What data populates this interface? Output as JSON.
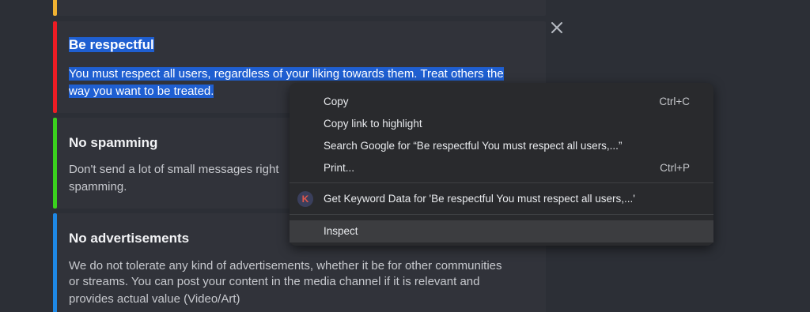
{
  "rules": [
    {
      "title": "",
      "description_lines": [],
      "bar_color": "#f0b232"
    },
    {
      "title": "Be respectful",
      "description_lines": [
        "You must respect all users, regardless of your liking towards them. Treat others the",
        "way you want to be treated."
      ],
      "bar_color": "#ed1c24",
      "selected": true
    },
    {
      "title": "No spamming",
      "description_lines": [
        "Don't send a lot of small messages right",
        "spamming."
      ],
      "bar_color": "#3ad11d"
    },
    {
      "title": "No advertisements",
      "description_lines": [
        "We do not tolerate any kind of advertisements, whether it be for other communities",
        "or streams. You can post your content in the media channel if it is relevant and",
        "provides actual value (Video/Art)"
      ],
      "bar_color": "#1e88e5"
    }
  ],
  "close_icon": "close-icon",
  "context_menu": {
    "items": [
      {
        "label": "Copy",
        "shortcut": "Ctrl+C"
      },
      {
        "label": "Copy link to highlight",
        "shortcut": ""
      },
      {
        "label": "Search Google for “Be respectful You must respect all users,...”",
        "shortcut": ""
      },
      {
        "label": "Print...",
        "shortcut": "Ctrl+P"
      },
      {
        "label": "Get Keyword Data for 'Be respectful You must respect all users,...'",
        "shortcut": "",
        "icon": "keyword-k-icon",
        "icon_letter": "K"
      },
      {
        "label": "Inspect",
        "shortcut": "",
        "hovered": true
      }
    ]
  },
  "colors": {
    "background": "#2c2f36",
    "card": "#31333a",
    "selection": "#1f5fd1",
    "menu_bg": "#292a2d",
    "menu_hover": "#3c3d40"
  }
}
